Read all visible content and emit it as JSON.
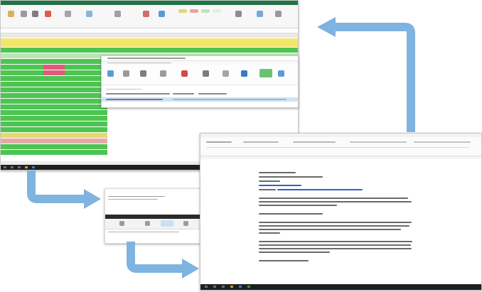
{
  "screens": {
    "spreadsheet": {
      "name": "spreadsheet-window"
    },
    "email_dialog": {
      "name": "email-dialog-window"
    },
    "small_window": {
      "name": "small-window"
    },
    "document": {
      "name": "document-window"
    }
  },
  "colors": {
    "arrow": "#7fb3e0",
    "sheet_green": "#4ec452",
    "sheet_yellow": "#f1e66b",
    "sheet_pink": "#e6a9a9",
    "taskbar": "#1f1f1f",
    "link_blue": "#2f5fd0"
  }
}
